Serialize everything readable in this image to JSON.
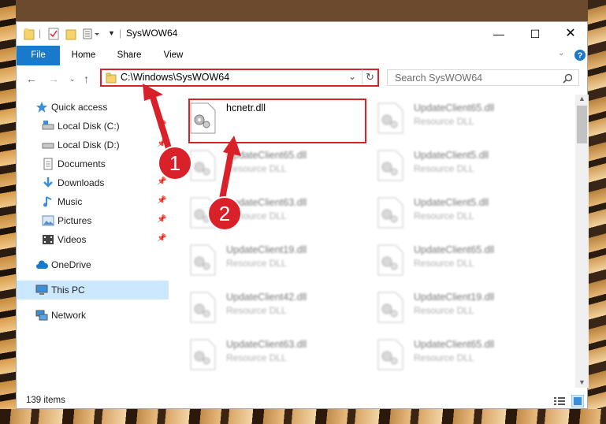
{
  "window": {
    "title": "SysWOW64"
  },
  "ribbon": {
    "tabs": [
      "File",
      "Home",
      "Share",
      "View"
    ]
  },
  "address": {
    "path": "C:\\Windows\\SysWOW64"
  },
  "search": {
    "placeholder": "Search SysWOW64"
  },
  "nav": {
    "items": [
      {
        "label": "Quick access"
      },
      {
        "label": "Local Disk (C:)"
      },
      {
        "label": "Local Disk (D:)"
      },
      {
        "label": "Documents"
      },
      {
        "label": "Downloads"
      },
      {
        "label": "Music"
      },
      {
        "label": "Pictures"
      },
      {
        "label": "Videos"
      },
      {
        "label": "OneDrive"
      },
      {
        "label": "This PC"
      },
      {
        "label": "Network"
      }
    ]
  },
  "files": [
    {
      "name": "hcnetr.dll",
      "type": ""
    },
    {
      "name": "UpdateClient65.dll",
      "type": "Resource DLL"
    },
    {
      "name": "UpdateClient65.dll",
      "type": "Resource DLL"
    },
    {
      "name": "UpdateClient5.dll",
      "type": "Resource DLL"
    },
    {
      "name": "UpdateClient63.dll",
      "type": "Resource DLL"
    },
    {
      "name": "UpdateClient5.dll",
      "type": "Resource DLL"
    },
    {
      "name": "UpdateClient19.dll",
      "type": "Resource DLL"
    },
    {
      "name": "UpdateClient65.dll",
      "type": "Resource DLL"
    },
    {
      "name": "UpdateClient42.dll",
      "type": "Resource DLL"
    },
    {
      "name": "UpdateClient19.dll",
      "type": "Resource DLL"
    },
    {
      "name": "UpdateClient63.dll",
      "type": "Resource DLL"
    },
    {
      "name": "UpdateClient65.dll",
      "type": "Resource DLL"
    }
  ],
  "status": {
    "count": "139 items"
  },
  "annotations": {
    "step1": "1",
    "step2": "2"
  },
  "colors": {
    "accent": "#1979ca",
    "highlight": "#d9212a",
    "selected": "#cce8ff"
  }
}
